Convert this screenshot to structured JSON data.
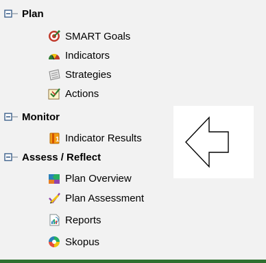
{
  "sections": [
    {
      "label": "Plan",
      "items": [
        {
          "label": "SMART Goals",
          "icon": "target-icon"
        },
        {
          "label": "Indicators",
          "icon": "gauge-icon"
        },
        {
          "label": "Strategies",
          "icon": "notepad-icon"
        },
        {
          "label": "Actions",
          "icon": "checklist-icon"
        }
      ]
    },
    {
      "label": "Monitor",
      "items": [
        {
          "label": "Indicator Results",
          "icon": "results-icon"
        }
      ]
    },
    {
      "label": "Assess / Reflect",
      "items": [
        {
          "label": "Plan Overview",
          "icon": "puzzle-icon"
        },
        {
          "label": "Plan Assessment",
          "icon": "checkmark-pencil-icon"
        },
        {
          "label": "Reports",
          "icon": "report-chart-icon"
        },
        {
          "label": "Skopus",
          "icon": "spinner-icon"
        }
      ]
    }
  ],
  "colors": {
    "background": "#f2f2f2",
    "callout": "#ffffff",
    "bottom_rule": "#2f6f2f"
  }
}
